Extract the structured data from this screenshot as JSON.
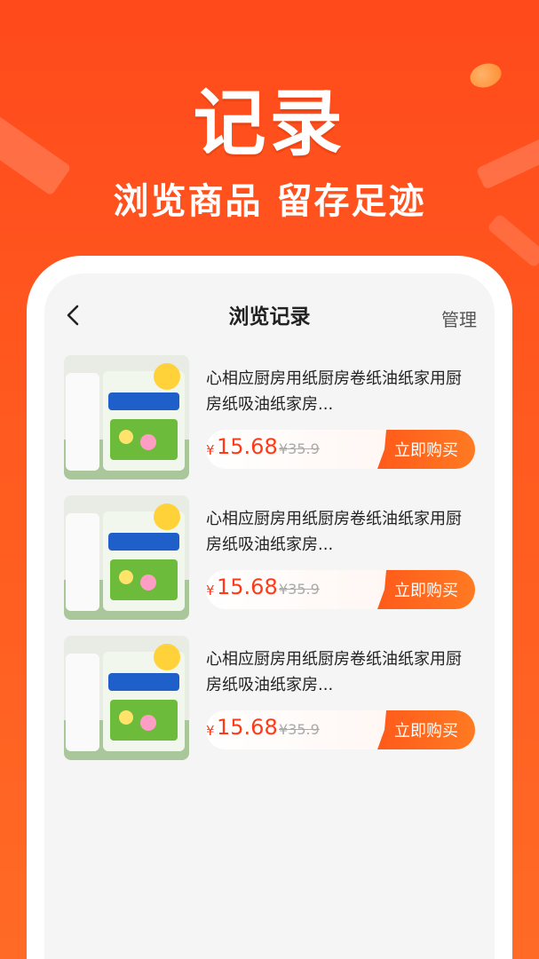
{
  "hero": {
    "title": "记录",
    "subtitle": "浏览商品 留存足迹"
  },
  "navbar": {
    "title": "浏览记录",
    "manage": "管理"
  },
  "colors": {
    "brand": "#ff4a1c",
    "price": "#ff3a18"
  },
  "items": [
    {
      "title": "心相应厨房用纸厨房卷纸油纸家用厨房纸吸油纸家房...",
      "currency": "¥",
      "price": "15.68",
      "old_price": "¥35.9",
      "buy_label": "立即购买"
    },
    {
      "title": "心相应厨房用纸厨房卷纸油纸家用厨房纸吸油纸家房...",
      "currency": "¥",
      "price": "15.68",
      "old_price": "¥35.9",
      "buy_label": "立即购买"
    },
    {
      "title": "心相应厨房用纸厨房卷纸油纸家用厨房纸吸油纸家房...",
      "currency": "¥",
      "price": "15.68",
      "old_price": "¥35.9",
      "buy_label": "立即购买"
    }
  ]
}
